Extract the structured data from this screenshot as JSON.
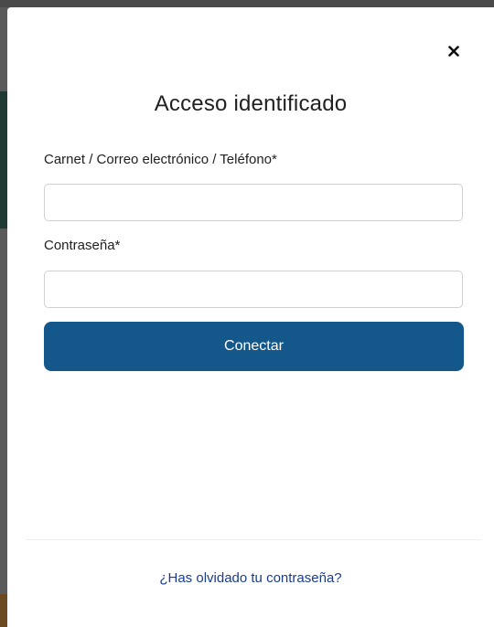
{
  "modal": {
    "title": "Acceso identificado",
    "close_icon": "close-icon",
    "user_label": "Carnet / Correo electrónico / Teléfono*",
    "user_value": "",
    "password_label": "Contraseña*",
    "password_value": "",
    "submit_label": "Conectar",
    "forgot_link": "¿Has olvidado tu contraseña?"
  },
  "colors": {
    "primary_button": "#13578b",
    "link": "#1a3c8e",
    "text": "#212121",
    "input_border": "#d0d0d0"
  }
}
